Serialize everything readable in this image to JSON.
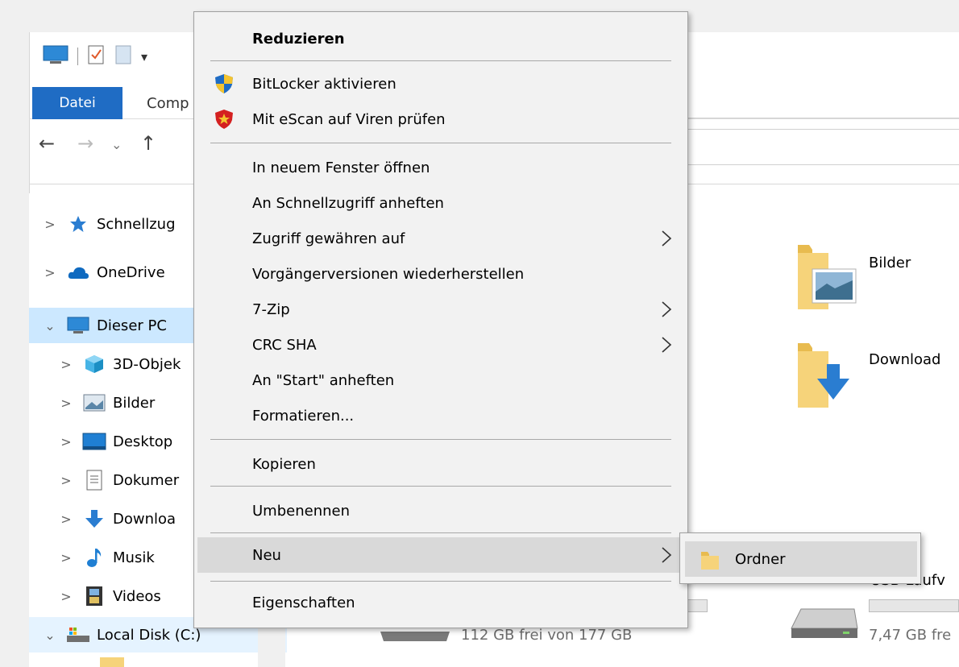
{
  "ribbon": {
    "tab_file": "Datei",
    "tab_computer": "Comp"
  },
  "nav_tree": [
    {
      "label": "Schnellzug",
      "icon": "star-icon"
    },
    {
      "label": "OneDrive",
      "icon": "cloud-icon"
    },
    {
      "label": "Dieser PC",
      "icon": "computer-icon"
    },
    {
      "label": "3D-Objek",
      "icon": "cube-icon"
    },
    {
      "label": "Bilder",
      "icon": "pictures-icon"
    },
    {
      "label": "Desktop",
      "icon": "desktop-icon"
    },
    {
      "label": "Dokumer",
      "icon": "document-icon"
    },
    {
      "label": "Downloa",
      "icon": "download-icon"
    },
    {
      "label": "Musik",
      "icon": "music-icon"
    },
    {
      "label": "Videos",
      "icon": "film-icon"
    },
    {
      "label": "Local Disk (C:)",
      "icon": "drive-icon"
    }
  ],
  "content": {
    "folders": [
      {
        "label": "Bilder"
      },
      {
        "label": "Download"
      }
    ],
    "drives": [
      {
        "label": "",
        "free": "112 GB frei von 177 GB"
      },
      {
        "label": "USB-Laufv",
        "free": "7,47 GB fre"
      }
    ]
  },
  "context_menu": {
    "items": [
      {
        "label": "Reduzieren"
      },
      {
        "label": "BitLocker aktivieren"
      },
      {
        "label": "Mit eScan auf Viren prüfen"
      },
      {
        "label": "In neuem Fenster öffnen"
      },
      {
        "label": "An Schnellzugriff anheften"
      },
      {
        "label": "Zugriff gewähren auf"
      },
      {
        "label": "Vorgängerversionen wiederherstellen"
      },
      {
        "label": "7-Zip"
      },
      {
        "label": "CRC SHA"
      },
      {
        "label": "An \"Start\" anheften"
      },
      {
        "label": "Formatieren..."
      },
      {
        "label": "Kopieren"
      },
      {
        "label": "Umbenennen"
      },
      {
        "label": "Neu"
      },
      {
        "label": "Eigenschaften"
      }
    ]
  },
  "submenu": {
    "items": [
      {
        "label": "Ordner"
      }
    ]
  },
  "colors": {
    "accent": "#1f6cc4",
    "selection": "#cce8ff",
    "menu_bg": "#f2f2f2",
    "menu_hot": "#d9d9d9",
    "folder": "#f6d37a"
  }
}
